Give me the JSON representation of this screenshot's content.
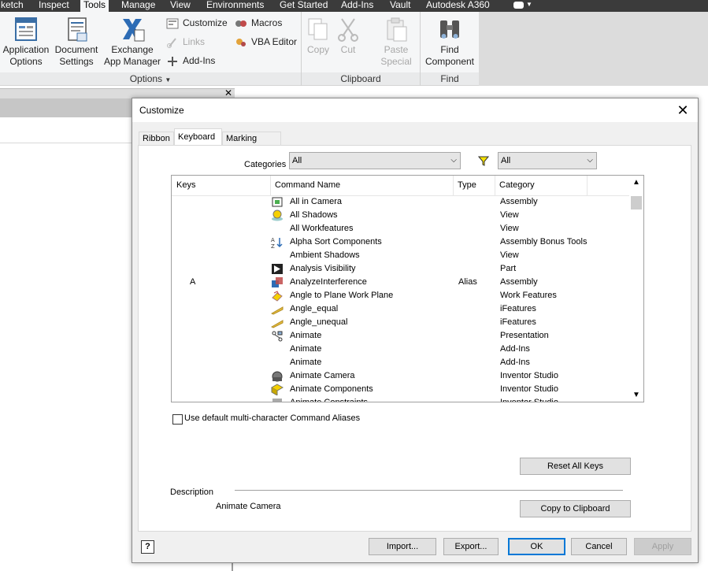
{
  "menu": {
    "items": [
      "ketch",
      "Inspect",
      "Tools",
      "Manage",
      "View",
      "Environments",
      "Get Started",
      "Add-Ins",
      "Vault",
      "Autodesk A360"
    ],
    "active": "Tools"
  },
  "ribbon": {
    "options": {
      "app_options": [
        "Application",
        "Options"
      ],
      "doc_settings": [
        "Document",
        "Settings"
      ],
      "exchange": [
        "Exchange",
        "App Manager"
      ],
      "customize": "Customize",
      "links": "Links",
      "addins": "Add-Ins",
      "macros": "Macros",
      "vba": "VBA Editor",
      "group": "Options"
    },
    "clipboard": {
      "copy": "Copy",
      "cut": "Cut",
      "paste_special": [
        "Paste",
        "Special"
      ],
      "group": "Clipboard"
    },
    "find": {
      "find_component": [
        "Find",
        "Component"
      ],
      "group": "Find"
    }
  },
  "dialog": {
    "title": "Customize",
    "tabs": [
      "Ribbon",
      "Keyboard",
      "Marking Menu"
    ],
    "selected_tab": "Keyboard",
    "categories_label": "Categories",
    "categories_value": "All",
    "filter_value": "All",
    "columns": [
      "Keys",
      "Command Name",
      "Type",
      "Category"
    ],
    "rows": [
      {
        "key": "",
        "icon": "all-in-camera-icon",
        "name": "All in Camera",
        "type": "",
        "category": "Assembly"
      },
      {
        "key": "",
        "icon": "all-shadows-icon",
        "name": "All Shadows",
        "type": "",
        "category": "View"
      },
      {
        "key": "",
        "icon": "",
        "name": "All Workfeatures",
        "type": "",
        "category": "View"
      },
      {
        "key": "",
        "icon": "alpha-sort-icon",
        "name": "Alpha Sort Components",
        "type": "",
        "category": "Assembly Bonus Tools"
      },
      {
        "key": "",
        "icon": "",
        "name": "Ambient Shadows",
        "type": "",
        "category": "View"
      },
      {
        "key": "",
        "icon": "analysis-visibility-icon",
        "name": "Analysis Visibility",
        "type": "",
        "category": "Part"
      },
      {
        "key": "A",
        "icon": "analyze-interference-icon",
        "name": "AnalyzeInterference",
        "type": "Alias",
        "category": "Assembly"
      },
      {
        "key": "",
        "icon": "angle-to-plane-icon",
        "name": "Angle to Plane Work Plane",
        "type": "",
        "category": "Work Features"
      },
      {
        "key": "",
        "icon": "angle-equal-icon",
        "name": "Angle_equal",
        "type": "",
        "category": "iFeatures"
      },
      {
        "key": "",
        "icon": "angle-unequal-icon",
        "name": "Angle_unequal",
        "type": "",
        "category": "iFeatures"
      },
      {
        "key": "",
        "icon": "animate-icon",
        "name": "Animate",
        "type": "",
        "category": "Presentation"
      },
      {
        "key": "",
        "icon": "",
        "name": "Animate",
        "type": "",
        "category": "Add-Ins"
      },
      {
        "key": "",
        "icon": "",
        "name": "Animate",
        "type": "",
        "category": "Add-Ins"
      },
      {
        "key": "",
        "icon": "animate-camera-icon",
        "name": "Animate Camera",
        "type": "",
        "category": "Inventor Studio"
      },
      {
        "key": "",
        "icon": "animate-components-icon",
        "name": "Animate Components",
        "type": "",
        "category": "Inventor Studio"
      },
      {
        "key": "",
        "icon": "animate-constraints-icon",
        "name": "Animate Constraints",
        "type": "",
        "category": "Inventor Studio"
      }
    ],
    "use_default_aliases": "Use default multi-character Command Aliases",
    "reset_all_keys": "Reset All Keys",
    "description_label": "Description",
    "description_value": "Animate Camera",
    "copy_to_clipboard": "Copy to Clipboard",
    "buttons": {
      "import": "Import...",
      "export": "Export...",
      "ok": "OK",
      "cancel": "Cancel",
      "apply": "Apply"
    },
    "help_glyph": "?"
  },
  "colors": {
    "menu_bg": "#3b3b3b",
    "ribbon_bg": "#f5f6f7",
    "accent": "#0078d7"
  }
}
